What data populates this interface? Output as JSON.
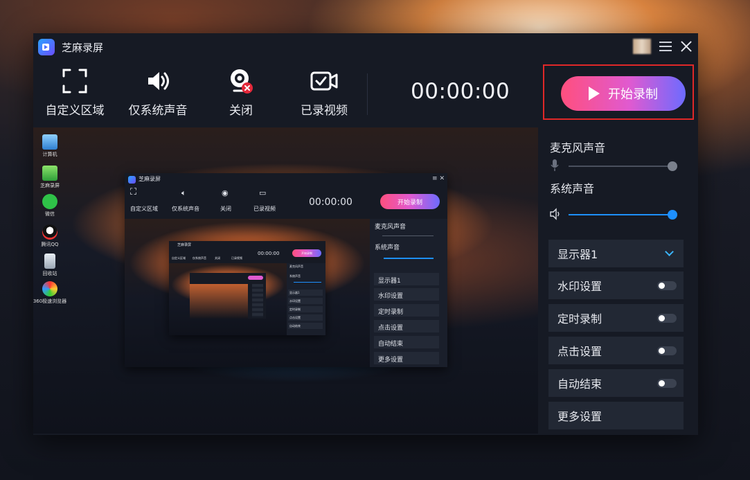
{
  "app": {
    "title": "芝麻录屏"
  },
  "toolbar": {
    "tools": [
      {
        "label": "自定义区域",
        "icon": "custom-area-icon"
      },
      {
        "label": "仅系统声音",
        "icon": "speaker-icon"
      },
      {
        "label": "关闭",
        "icon": "webcam-off-icon"
      },
      {
        "label": "已录视频",
        "icon": "video-check-icon"
      }
    ],
    "timer": "00:00:00",
    "record_label": "开始录制"
  },
  "settings": {
    "mic_label": "麦克风声音",
    "mic_level": 1.0,
    "system_label": "系统声音",
    "system_level": 1.0,
    "display_label": "显示器1",
    "options": [
      {
        "label": "水印设置",
        "on": false
      },
      {
        "label": "定时录制",
        "on": false
      },
      {
        "label": "点击设置",
        "on": false
      },
      {
        "label": "自动结束",
        "on": false
      }
    ],
    "more_label": "更多设置"
  },
  "desktop": {
    "icons": [
      {
        "label": "计算机"
      },
      {
        "label": "芝麻录屏"
      },
      {
        "label": "微信"
      },
      {
        "label": "腾讯QQ"
      },
      {
        "label": "回收站"
      },
      {
        "label": "360极速浏览器"
      }
    ]
  },
  "colors": {
    "accent_blue": "#1e90ff",
    "record_gradient_start": "#ff4f7e",
    "record_gradient_end": "#6d6bff",
    "highlight_red": "#e02828"
  }
}
